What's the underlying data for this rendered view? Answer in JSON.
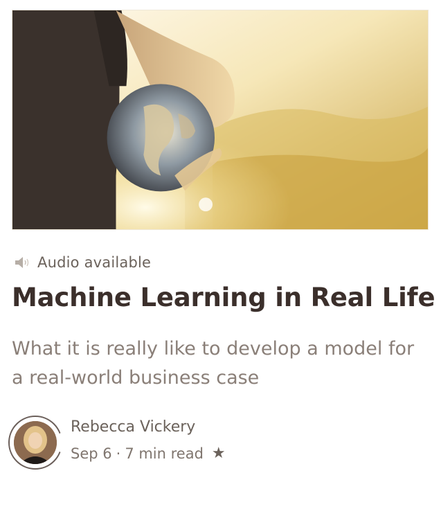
{
  "article": {
    "audio_label": "Audio available",
    "title": "Machine Learning in Real Life",
    "subtitle": "What it is really like to develop a model for a real-world business case",
    "author_name": "Rebecca Vickery",
    "date": "Sep 6",
    "separator": "·",
    "read_time": "7 min read",
    "star_glyph": "★"
  },
  "icons": {
    "audio": "speaker-icon",
    "bookmark": "star-icon"
  },
  "colors": {
    "title": "#3b2f2b",
    "subtitle": "#8a7f78",
    "meta": "#7f756e",
    "hero_tint": "#e8c96a"
  }
}
